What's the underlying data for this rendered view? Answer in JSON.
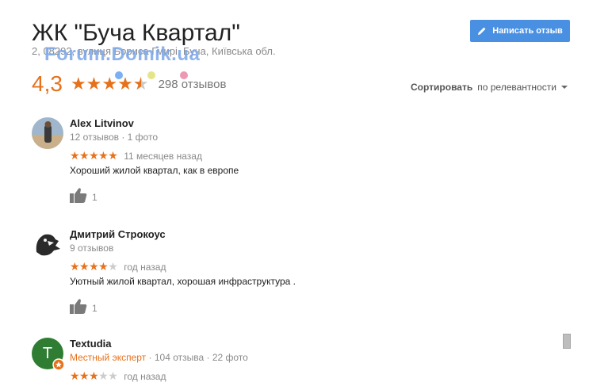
{
  "header": {
    "title": "ЖК \"Буча Квартал\"",
    "address": "2, 08292, вулиця Бориса Гмирі, Буча, Київська обл.",
    "watermark": "Forum.Domik.ua",
    "write_review_label": "Написать отзыв"
  },
  "summary": {
    "rating": "4,3",
    "rating_value": 4.3,
    "review_count": "298 отзывов",
    "sort_label": "Сортировать",
    "sort_value": "по релевантности"
  },
  "reviews": [
    {
      "name": "Alex Litvinov",
      "meta": "12 отзывов · 1 фото",
      "stars": 5,
      "date": "11 месяцев назад",
      "text": "Хороший жилой квартал, как в европе",
      "likes": "1"
    },
    {
      "name": "Дмитрий Строкоус",
      "meta": "9 отзывов",
      "stars": 4,
      "date": "год назад",
      "text": "Уютный жилой квартал, хорошая инфраструктура .",
      "likes": "1"
    },
    {
      "name": "Textudia",
      "expert_label": "Местный эксперт",
      "meta": " · 104 отзыва · 22 фото",
      "avatar_letter": "T",
      "stars": 3,
      "date": "год назад"
    }
  ],
  "colors": {
    "accent_orange": "#e7711b",
    "button_blue": "#4a90e2",
    "avatar_green": "#2e7d32"
  }
}
